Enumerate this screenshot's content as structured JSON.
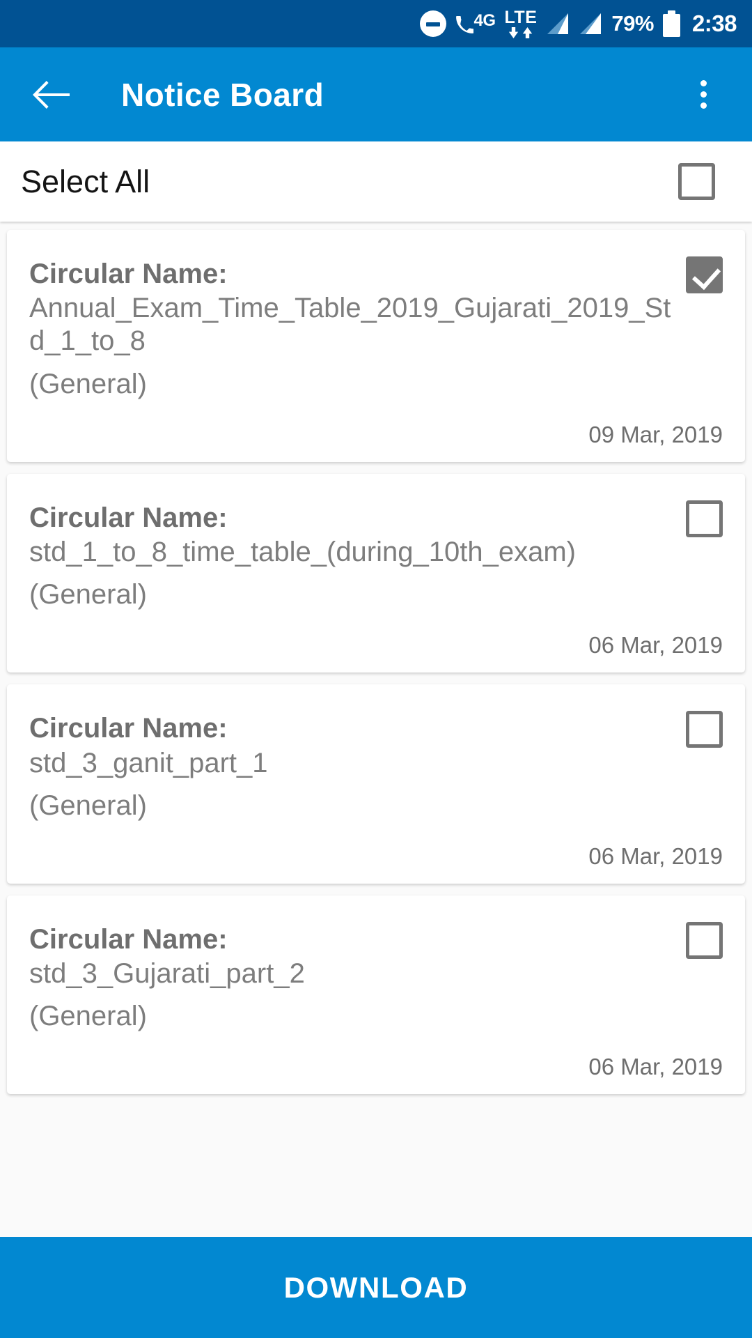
{
  "statusbar": {
    "icons": [
      "do-not-disturb-icon",
      "call-4g-icon",
      "lte-data-icon",
      "signal-bars-sim1-icon",
      "signal-bars-sim2-icon",
      "battery-icon"
    ],
    "network_4g": "4G",
    "network_lte": "LTE",
    "battery_percent": "79%",
    "time": "2:38"
  },
  "appbar": {
    "back_icon": "arrow-back-icon",
    "title": "Notice Board",
    "overflow_icon": "more-vert-icon"
  },
  "select_all": {
    "label": "Select All",
    "checked": false
  },
  "list": {
    "circular_label": "Circular Name:",
    "items": [
      {
        "name": "Annual_Exam_Time_Table_2019_Gujarati_2019_Std_1_to_8",
        "type": "(General)",
        "date": "09 Mar, 2019",
        "checked": true
      },
      {
        "name": "std_1_to_8_time_table_(during_10th_exam)",
        "type": "(General)",
        "date": "06 Mar, 2019",
        "checked": false
      },
      {
        "name": "std_3_ganit_part_1",
        "type": "(General)",
        "date": "06 Mar, 2019",
        "checked": false
      },
      {
        "name": "std_3_Gujarati_part_2",
        "type": "(General)",
        "date": "06 Mar, 2019",
        "checked": false
      }
    ]
  },
  "footer": {
    "download_label": "DOWNLOAD"
  },
  "colors": {
    "statusbar_bg": "#015293",
    "appbar_bg": "#0288d1",
    "accent": "#0288d1",
    "text_gray": "#7d7d7d",
    "checkbox_gray": "#757575"
  }
}
